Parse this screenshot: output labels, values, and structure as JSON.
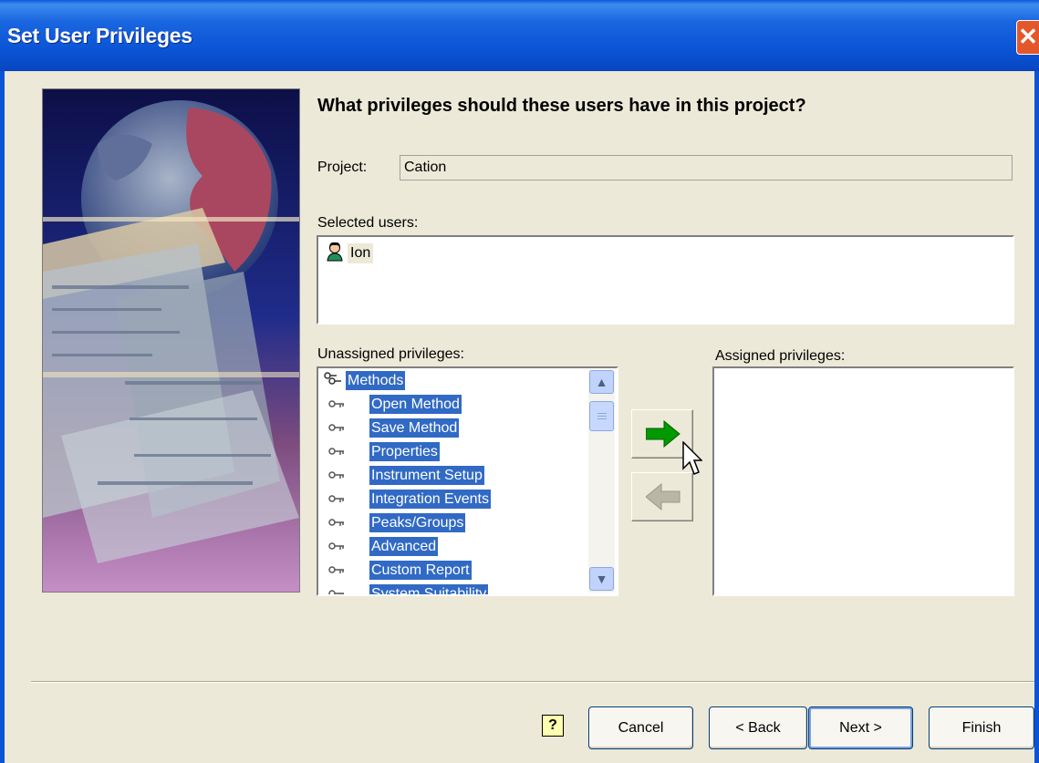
{
  "window": {
    "title": "Set User Privileges",
    "close_symbol": "✕"
  },
  "heading": "What privileges should these users have in this project?",
  "project": {
    "label": "Project:",
    "value": "Cation"
  },
  "selected_users": {
    "label": "Selected users:",
    "items": [
      "Ion"
    ]
  },
  "unassigned": {
    "label": "Unassigned privileges:",
    "root": "Methods",
    "items": [
      "Open Method",
      "Save Method",
      "Properties",
      "Instrument Setup",
      "Integration Events",
      "Peaks/Groups",
      "Advanced",
      "Custom Report",
      "System Suitability"
    ]
  },
  "assigned": {
    "label": "Assigned privileges:",
    "items": []
  },
  "buttons": {
    "help": "?",
    "cancel": "Cancel",
    "back": "< Back",
    "next": "Next >",
    "finish": "Finish"
  },
  "icons": {
    "add": "arrow-right-icon",
    "remove": "arrow-left-icon",
    "user": "user-icon",
    "key": "key-icon",
    "root": "methods-group-icon"
  },
  "colors": {
    "selection": "#316ac5",
    "add_arrow": "#009a00",
    "titlebar": "#0b54d6"
  }
}
